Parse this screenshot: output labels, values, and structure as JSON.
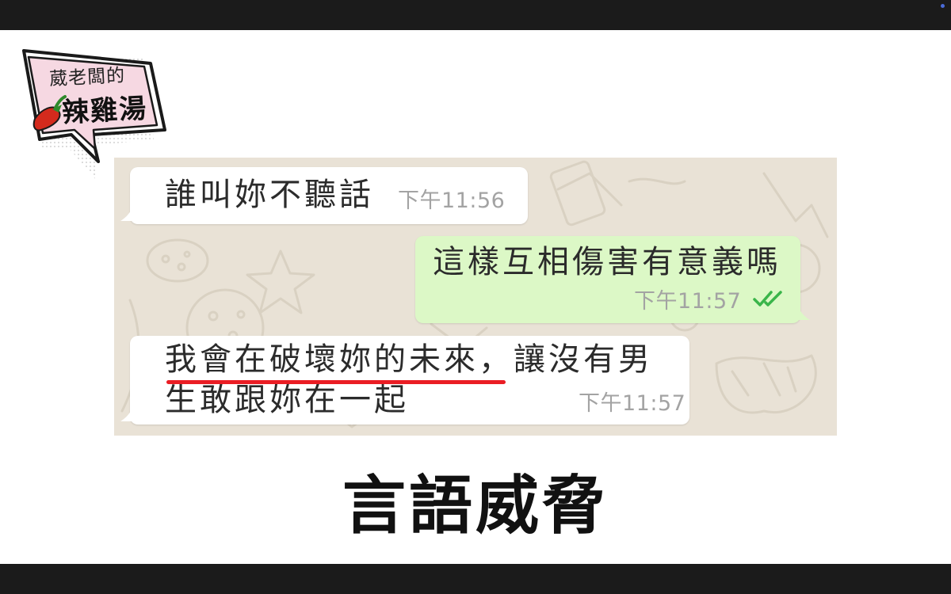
{
  "logo": {
    "line1": "葳老闆的",
    "line2": "辣雞湯"
  },
  "chat": {
    "messages": [
      {
        "direction": "incoming",
        "text": "誰叫妳不聽話",
        "time": "下午11:56"
      },
      {
        "direction": "outgoing",
        "text": "這樣互相傷害有意義嗎",
        "time": "下午11:57",
        "status_icon": "double-check-icon"
      },
      {
        "direction": "incoming",
        "line1": "我會在破壞妳的未來，讓沒有男",
        "line2": "生敢跟妳在一起",
        "time": "下午11:57",
        "highlight": "我會在破壞妳的未來"
      }
    ]
  },
  "caption": "言語威脅",
  "colors": {
    "chat_background": "#e9e2d6",
    "incoming_bubble": "#ffffff",
    "outgoing_bubble": "#dcf8c6",
    "read_ticks": "#34b7f1",
    "underline": "#ea1d24",
    "letterbox": "#1b1b1b"
  }
}
